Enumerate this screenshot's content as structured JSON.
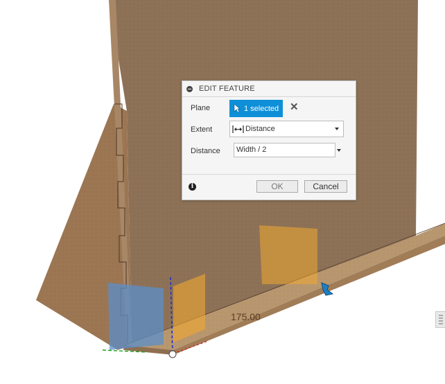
{
  "viewport": {
    "dimension_value": "175.00"
  },
  "dialog": {
    "title": "EDIT FEATURE",
    "plane": {
      "label": "Plane",
      "value": "1 selected"
    },
    "extent": {
      "label": "Extent",
      "value": "Distance",
      "icon": "distance-arrows-icon"
    },
    "distance": {
      "label": "Distance",
      "value": "Width / 2"
    },
    "buttons": {
      "ok": "OK",
      "cancel": "Cancel"
    }
  },
  "colors": {
    "accent": "#0e8fd8",
    "mdf_light": "#9a7a5a",
    "mdf_dark": "#7e6247",
    "selection_blue": "#5b8fc9",
    "preview_orange": "#f0a830"
  }
}
